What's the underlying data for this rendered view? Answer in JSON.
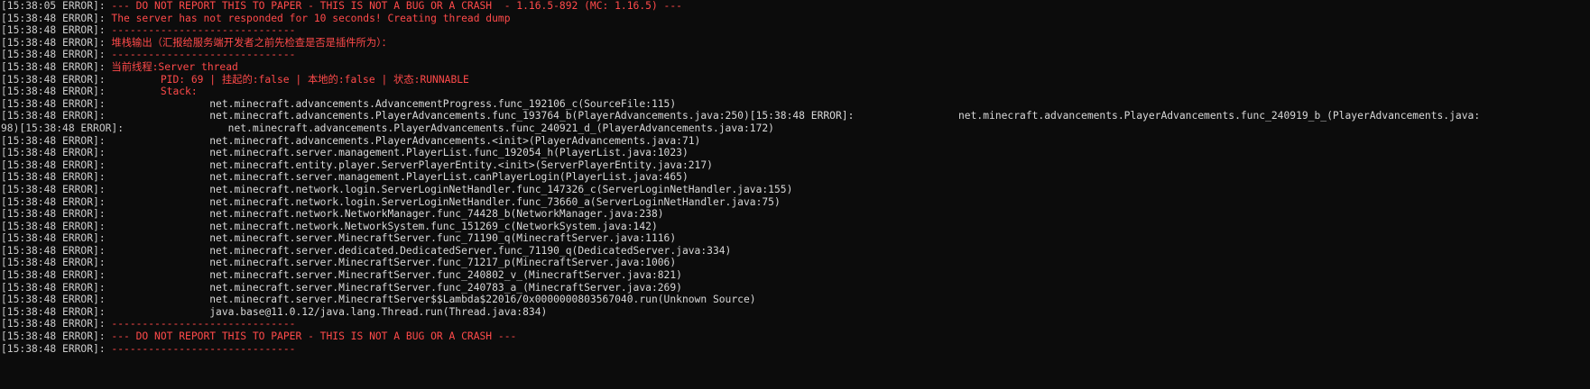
{
  "window": {
    "background": "#0c0c0c",
    "prefix_color": "#cccccc",
    "error_color": "#ff4a4a",
    "stack_color": "#d8d8d8"
  },
  "lines": [
    {
      "prefix": "[15:38:05 ERROR]:",
      "text": " --- DO NOT REPORT THIS TO PAPER - THIS IS NOT A BUG OR A CRASH  - 1.16.5-892 (MC: 1.16.5) ---",
      "kind": "error"
    },
    {
      "prefix": "[15:38:48 ERROR]:",
      "text": " The server has not responded for 10 seconds! Creating thread dump",
      "kind": "error"
    },
    {
      "prefix": "[15:38:48 ERROR]:",
      "text": " ------------------------------",
      "kind": "error"
    },
    {
      "prefix": "[15:38:48 ERROR]:",
      "text": " 堆栈输出（汇报给服务端开发者之前先检查是否是插件所为）：",
      "kind": "error"
    },
    {
      "prefix": "[15:38:48 ERROR]:",
      "text": " ------------------------------",
      "kind": "error"
    },
    {
      "prefix": "[15:38:48 ERROR]:",
      "text": " 当前线程:Server thread",
      "kind": "error"
    },
    {
      "prefix": "[15:38:48 ERROR]:",
      "text": "         PID: 69 | 挂起的:false | 本地的:false | 状态:RUNNABLE",
      "kind": "error"
    },
    {
      "prefix": "[15:38:48 ERROR]:",
      "text": "         Stack:",
      "kind": "error"
    },
    {
      "prefix": "[15:38:48 ERROR]:",
      "text": "                 net.minecraft.advancements.AdvancementProgress.func_192106_c(SourceFile:115)",
      "kind": "stack"
    },
    {
      "prefix": "[15:38:48 ERROR]:",
      "text": "                 net.minecraft.advancements.PlayerAdvancements.func_193764_b(PlayerAdvancements.java:250)[15:38:48 ERROR]:                 net.minecraft.advancements.PlayerAdvancements.func_240919_b_(PlayerAdvancements.java:",
      "kind": "stack"
    },
    {
      "prefix": "98)[15:38:48 ERROR]:",
      "text": "                 net.minecraft.advancements.PlayerAdvancements.func_240921_d_(PlayerAdvancements.java:172)",
      "kind": "stack"
    },
    {
      "prefix": "[15:38:48 ERROR]:",
      "text": "                 net.minecraft.advancements.PlayerAdvancements.<init>(PlayerAdvancements.java:71)",
      "kind": "stack"
    },
    {
      "prefix": "[15:38:48 ERROR]:",
      "text": "                 net.minecraft.server.management.PlayerList.func_192054_h(PlayerList.java:1023)",
      "kind": "stack"
    },
    {
      "prefix": "[15:38:48 ERROR]:",
      "text": "                 net.minecraft.entity.player.ServerPlayerEntity.<init>(ServerPlayerEntity.java:217)",
      "kind": "stack"
    },
    {
      "prefix": "[15:38:48 ERROR]:",
      "text": "                 net.minecraft.server.management.PlayerList.canPlayerLogin(PlayerList.java:465)",
      "kind": "stack"
    },
    {
      "prefix": "[15:38:48 ERROR]:",
      "text": "                 net.minecraft.network.login.ServerLoginNetHandler.func_147326_c(ServerLoginNetHandler.java:155)",
      "kind": "stack"
    },
    {
      "prefix": "[15:38:48 ERROR]:",
      "text": "                 net.minecraft.network.login.ServerLoginNetHandler.func_73660_a(ServerLoginNetHandler.java:75)",
      "kind": "stack"
    },
    {
      "prefix": "[15:38:48 ERROR]:",
      "text": "                 net.minecraft.network.NetworkManager.func_74428_b(NetworkManager.java:238)",
      "kind": "stack"
    },
    {
      "prefix": "[15:38:48 ERROR]:",
      "text": "                 net.minecraft.network.NetworkSystem.func_151269_c(NetworkSystem.java:142)",
      "kind": "stack"
    },
    {
      "prefix": "[15:38:48 ERROR]:",
      "text": "                 net.minecraft.server.MinecraftServer.func_71190_q(MinecraftServer.java:1116)",
      "kind": "stack"
    },
    {
      "prefix": "[15:38:48 ERROR]:",
      "text": "                 net.minecraft.server.dedicated.DedicatedServer.func_71190_q(DedicatedServer.java:334)",
      "kind": "stack"
    },
    {
      "prefix": "[15:38:48 ERROR]:",
      "text": "                 net.minecraft.server.MinecraftServer.func_71217_p(MinecraftServer.java:1006)",
      "kind": "stack"
    },
    {
      "prefix": "[15:38:48 ERROR]:",
      "text": "                 net.minecraft.server.MinecraftServer.func_240802_v_(MinecraftServer.java:821)",
      "kind": "stack"
    },
    {
      "prefix": "[15:38:48 ERROR]:",
      "text": "                 net.minecraft.server.MinecraftServer.func_240783_a_(MinecraftServer.java:269)",
      "kind": "stack"
    },
    {
      "prefix": "[15:38:48 ERROR]:",
      "text": "                 net.minecraft.server.MinecraftServer$$Lambda$22016/0x0000000803567040.run(Unknown Source)",
      "kind": "stack"
    },
    {
      "prefix": "[15:38:48 ERROR]:",
      "text": "                 java.base@11.0.12/java.lang.Thread.run(Thread.java:834)",
      "kind": "stack"
    },
    {
      "prefix": "[15:38:48 ERROR]:",
      "text": " ------------------------------",
      "kind": "error"
    },
    {
      "prefix": "[15:38:48 ERROR]:",
      "text": " --- DO NOT REPORT THIS TO PAPER - THIS IS NOT A BUG OR A CRASH ---",
      "kind": "error"
    },
    {
      "prefix": "[15:38:48 ERROR]:",
      "text": " ------------------------------",
      "kind": "error"
    }
  ]
}
